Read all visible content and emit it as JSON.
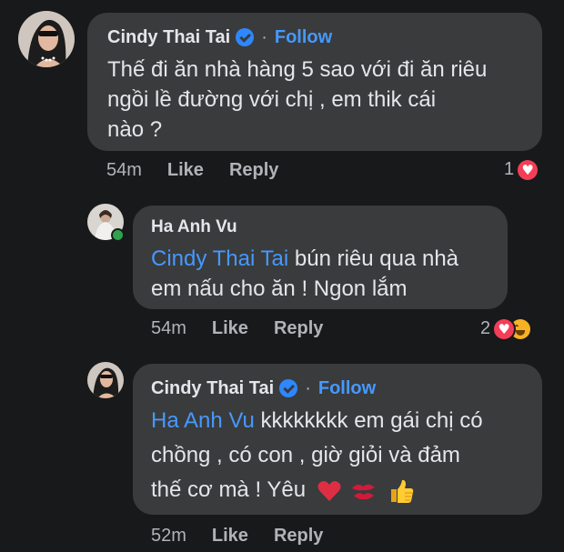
{
  "comments": [
    {
      "author": "Cindy Thai Tai",
      "verified": true,
      "follow_label": "Follow",
      "separator": "·",
      "text_line1": "Thế đi ăn nhà hàng 5 sao với đi ăn riêu",
      "text_line2": "ngồi lề đường với chị , em thik cái",
      "text_line3": "nào ?",
      "time": "54m",
      "like_label": "Like",
      "reply_label": "Reply",
      "reaction_count": "1",
      "reactions": [
        "heart-react"
      ]
    },
    {
      "author": "Ha Anh Vu",
      "verified": false,
      "mention": "Cindy Thai Tai",
      "text_line1_rest": " bún riêu qua nhà",
      "text_line2": "em nấu cho ăn ! Ngon lắm",
      "time": "54m",
      "like_label": "Like",
      "reply_label": "Reply",
      "reaction_count": "2",
      "reactions": [
        "heart-react",
        "haha-react"
      ]
    },
    {
      "author": "Cindy Thai Tai",
      "verified": true,
      "follow_label": "Follow",
      "separator": "·",
      "mention": "Ha Anh Vu",
      "text_line1_rest": " kkkkkkkk em gái chị có",
      "text_line2": "chồng , có con , giờ giỏi và đảm",
      "text_line3": "thế cơ mà ! Yêu",
      "emojis": [
        "red-heart",
        "kiss-mark",
        "thumbs-up"
      ],
      "time": "52m",
      "like_label": "Like",
      "reply_label": "Reply"
    }
  ],
  "colors": {
    "background": "#18191a",
    "bubble": "#3a3b3c",
    "text": "#e4e6eb",
    "meta": "#b0b3b8",
    "link": "#4599ff",
    "verified": "#2d88ff",
    "love": "#f33e58",
    "haha": "#f7b125"
  }
}
